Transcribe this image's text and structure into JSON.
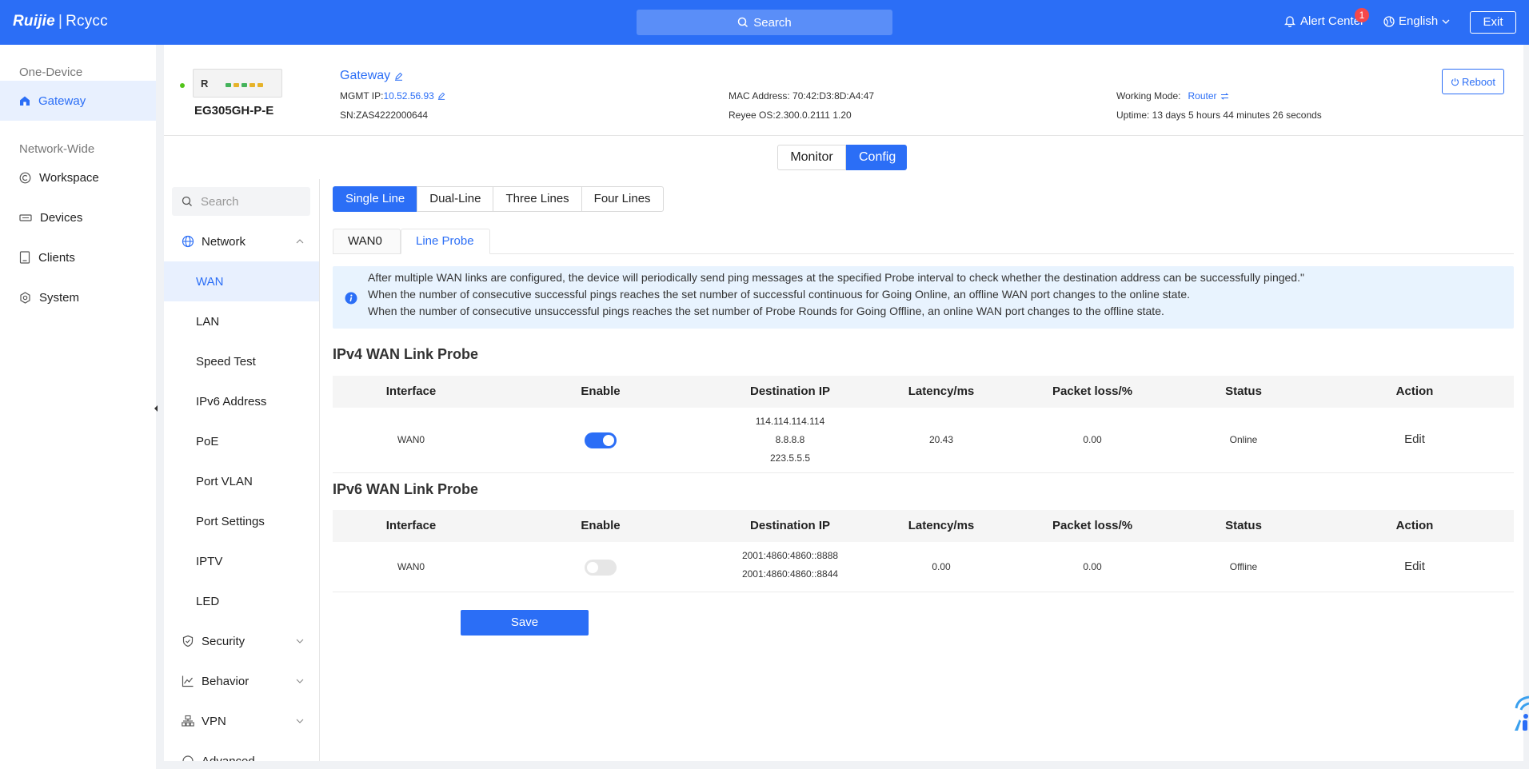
{
  "topbar": {
    "brand_primary": "Ruijie",
    "brand_separator": "|",
    "brand_secondary": "Rcycc",
    "search_label": "Search",
    "alert_label": "Alert Center",
    "alert_count": "1",
    "language": "English",
    "exit_label": "Exit"
  },
  "sidebar": {
    "group_one_device": "One-Device",
    "group_network_wide": "Network-Wide",
    "items": [
      {
        "label": "Gateway",
        "icon": "home-icon",
        "active": true
      },
      {
        "label": "Workspace",
        "icon": "workspace-icon"
      },
      {
        "label": "Devices",
        "icon": "devices-icon"
      },
      {
        "label": "Clients",
        "icon": "clients-icon"
      },
      {
        "label": "System",
        "icon": "gear-icon"
      }
    ]
  },
  "device": {
    "name": "Gateway",
    "model": "EG305GH-P-E",
    "badge_letter": "R",
    "mgmt_ip_label": "MGMT IP:",
    "mgmt_ip": "10.52.56.93",
    "sn": "SN:ZAS4222000644",
    "mac": "MAC Address: 70:42:D3:8D:A4:47",
    "os": "Reyee OS:2.300.0.2111 1.20",
    "working_mode_label": "Working Mode:",
    "working_mode": "Router",
    "uptime": "Uptime: 13 days 5 hours 44 minutes 26 seconds",
    "reboot_label": "Reboot"
  },
  "mode_switch": {
    "monitor": "Monitor",
    "config": "Config"
  },
  "subnav": {
    "search_placeholder": "Search",
    "network": "Network",
    "children": [
      "WAN",
      "LAN",
      "Speed Test",
      "IPv6 Address",
      "PoE",
      "Port VLAN",
      "Port Settings",
      "IPTV",
      "LED"
    ],
    "security": "Security",
    "behavior": "Behavior",
    "vpn": "VPN",
    "advanced": "Advanced"
  },
  "line_tabs": [
    "Single Line",
    "Dual-Line",
    "Three Lines",
    "Four Lines"
  ],
  "card_tabs": [
    "WAN0",
    "Line Probe"
  ],
  "notice": [
    "After multiple WAN links are configured, the device will periodically send ping messages at the specified Probe interval to check whether the destination address can be successfully pinged.\"",
    "When the number of consecutive successful pings reaches the set number of successful continuous for Going Online, an offline WAN port changes to the online state.",
    "When the number of consecutive unsuccessful pings reaches the set number of Probe Rounds for Going Offline, an online WAN port changes to the offline state."
  ],
  "columns": [
    "Interface",
    "Enable",
    "Destination IP",
    "Latency/ms",
    "Packet loss/%",
    "Status",
    "Action"
  ],
  "ipv4": {
    "title": "IPv4 WAN Link Probe",
    "row": {
      "interface": "WAN0",
      "enabled": true,
      "ips": [
        "114.114.114.114",
        "8.8.8.8",
        "223.5.5.5"
      ],
      "latency": "20.43",
      "loss": "0.00",
      "status": "Online",
      "action": "Edit"
    }
  },
  "ipv6": {
    "title": "IPv6 WAN Link Probe",
    "row": {
      "interface": "WAN0",
      "enabled": false,
      "ips": [
        "2001:4860:4860::8888",
        "2001:4860:4860::8844"
      ],
      "latency": "0.00",
      "loss": "0.00",
      "status": "Offline",
      "action": "Edit"
    }
  },
  "save_label": "Save",
  "colors": {
    "accent": "#2b6ef6",
    "online": "#2b6ef6",
    "offline": "#f5484a",
    "notice_bg": "#e8f3fe"
  }
}
